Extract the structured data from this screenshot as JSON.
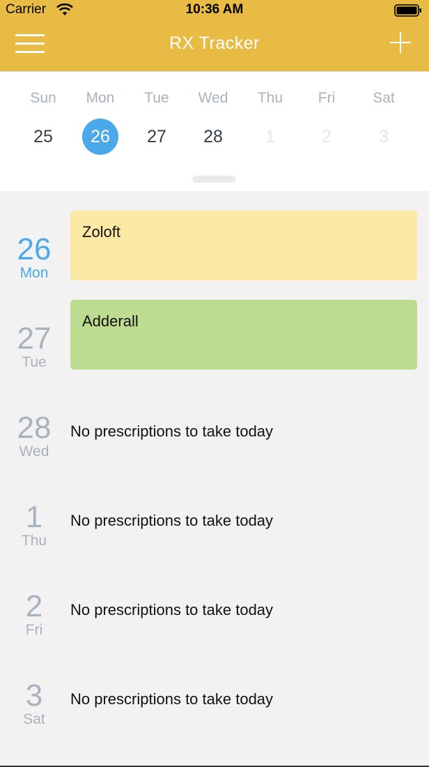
{
  "status_bar": {
    "carrier": "Carrier",
    "time": "10:36 AM"
  },
  "nav": {
    "title": "RX Tracker",
    "menu_icon": "hamburger-menu-icon",
    "add_icon": "plus-icon"
  },
  "week": {
    "days": [
      {
        "name": "Sun",
        "num": "25"
      },
      {
        "name": "Mon",
        "num": "26"
      },
      {
        "name": "Tue",
        "num": "27"
      },
      {
        "name": "Wed",
        "num": "28"
      },
      {
        "name": "Thu",
        "num": "1"
      },
      {
        "name": "Fri",
        "num": "2"
      },
      {
        "name": "Sat",
        "num": "3"
      }
    ]
  },
  "agenda": [
    {
      "num": "26",
      "day": "Mon",
      "prescription": "Zoloft",
      "color": "#fce9a3"
    },
    {
      "num": "27",
      "day": "Tue",
      "prescription": "Adderall",
      "color": "#bddc8f"
    },
    {
      "num": "28",
      "day": "Wed",
      "empty_text": "No prescriptions to take today"
    },
    {
      "num": "1",
      "day": "Thu",
      "empty_text": "No prescriptions to take today"
    },
    {
      "num": "2",
      "day": "Fri",
      "empty_text": "No prescriptions to take today"
    },
    {
      "num": "3",
      "day": "Sat",
      "empty_text": "No prescriptions to take today"
    }
  ],
  "colors": {
    "header": "#e8bb45",
    "accent": "#4ba9ea",
    "background": "#f2f2f2"
  }
}
